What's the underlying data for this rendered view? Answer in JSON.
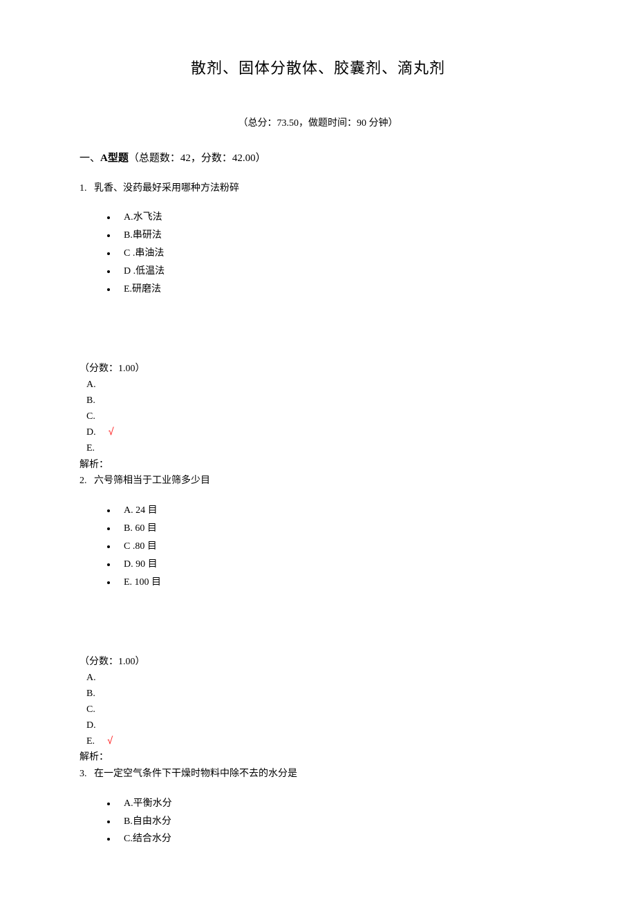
{
  "title": "散剂、固体分散体、胶囊剂、滴丸剂",
  "subtitle": "（总分：73.50，做题时间：90 分钟）",
  "section": {
    "prefix": "一、",
    "name": "A型题",
    "tail": "（总题数：42，分数：42.00）"
  },
  "questions": [
    {
      "num": "1.",
      "stem": "乳香、没药最好采用哪种方法粉碎",
      "options": [
        {
          "label": "A.水飞法"
        },
        {
          "label": "B.串研法"
        },
        {
          "label": "C .串油法"
        },
        {
          "label": "D .低温法"
        },
        {
          "label": "E.研磨法"
        }
      ],
      "score_line": "（分数：1.00）",
      "answer_letters": [
        "A.",
        "B.",
        "C.",
        "D.",
        "E."
      ],
      "correct_index": 3,
      "correct_mark": "√",
      "analysis": "解析："
    },
    {
      "num": "2.",
      "stem": "六号筛相当于工业筛多少目",
      "options": [
        {
          "label": "A. 24 目"
        },
        {
          "label": "B. 60 目"
        },
        {
          "label": "C .80 目"
        },
        {
          "label": "D. 90 目"
        },
        {
          "label": "E. 100 目"
        }
      ],
      "score_line": "（分数：1.00）",
      "answer_letters": [
        "A.",
        "B.",
        "C.",
        "D.",
        "E."
      ],
      "correct_index": 4,
      "correct_mark": "√",
      "analysis": "解析："
    },
    {
      "num": "3.",
      "stem": "在一定空气条件下干燥时物料中除不去的水分是",
      "options": [
        {
          "label": "A.平衡水分"
        },
        {
          "label": "B.自由水分"
        },
        {
          "label": "C.结合水分"
        }
      ]
    }
  ]
}
